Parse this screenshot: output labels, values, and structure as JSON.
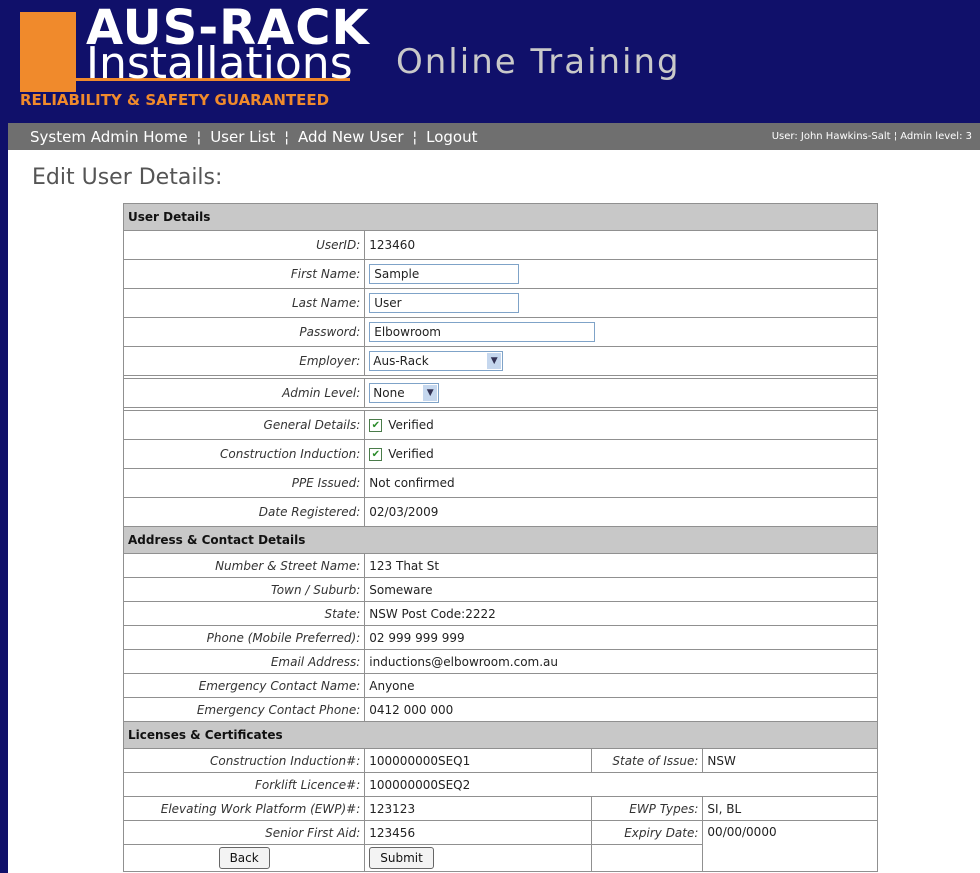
{
  "header": {
    "logo_word1": "AUS-RACK",
    "logo_word2": "Installations",
    "logo_tag": "RELIABILITY & SAFETY GUARANTEED",
    "site_title": "Online Training"
  },
  "nav": {
    "links": [
      "System Admin Home",
      "User List",
      "Add New User",
      "Logout"
    ],
    "separator": "¦",
    "user_info": "User: John Hawkins-Salt ¦ Admin level: 3"
  },
  "page_title": "Edit User Details:",
  "user_details": {
    "heading": "User Details",
    "userid_label": "UserID:",
    "userid": "123460",
    "first_name_label": "First Name:",
    "first_name": "Sample",
    "last_name_label": "Last Name:",
    "last_name": "User",
    "password_label": "Password:",
    "password": "Elbowroom",
    "employer_label": "Employer:",
    "employer": "Aus-Rack",
    "admin_level_label": "Admin Level:",
    "admin_level": "None",
    "general_details_label": "General Details:",
    "general_details": "Verified",
    "construction_induction_label": "Construction Induction:",
    "construction_induction": "Verified",
    "ppe_label": "PPE Issued:",
    "ppe": "Not confirmed",
    "date_registered_label": "Date Registered:",
    "date_registered": "02/03/2009"
  },
  "address": {
    "heading": "Address & Contact Details",
    "street_label": "Number & Street Name:",
    "street": "123 That St",
    "town_label": "Town / Suburb:",
    "town": "Someware",
    "state_label": "State:",
    "state": "NSW Post Code:2222",
    "phone_label": "Phone (Mobile Preferred):",
    "phone": "02 999 999 999",
    "email_label": "Email Address:",
    "email": "inductions@elbowroom.com.au",
    "em_name_label": "Emergency Contact Name:",
    "em_name": "Anyone",
    "em_phone_label": "Emergency Contact Phone:",
    "em_phone": "0412 000 000"
  },
  "licenses": {
    "heading": "Licenses & Certificates",
    "ci_label": "Construction Induction#:",
    "ci": "100000000SEQ1",
    "state_issue_label": "State of Issue:",
    "state_issue": "NSW",
    "forklift_label": "Forklift Licence#:",
    "forklift": "100000000SEQ2",
    "ewp_label": "Elevating Work Platform (EWP)#:",
    "ewp": "123123",
    "ewp_types_label": "EWP Types:",
    "ewp_types": "SI, BL",
    "sfa_label": "Senior First Aid:",
    "sfa": "123456",
    "expiry_label": "Expiry Date:",
    "expiry": "00/00/0000"
  },
  "buttons": {
    "back": "Back",
    "submit": "Submit"
  },
  "colors": {
    "header_bg": "#10106a",
    "brand_orange": "#f08a2c",
    "nav_bg": "#6f6f6f",
    "section_bg": "#c8c8c8"
  }
}
